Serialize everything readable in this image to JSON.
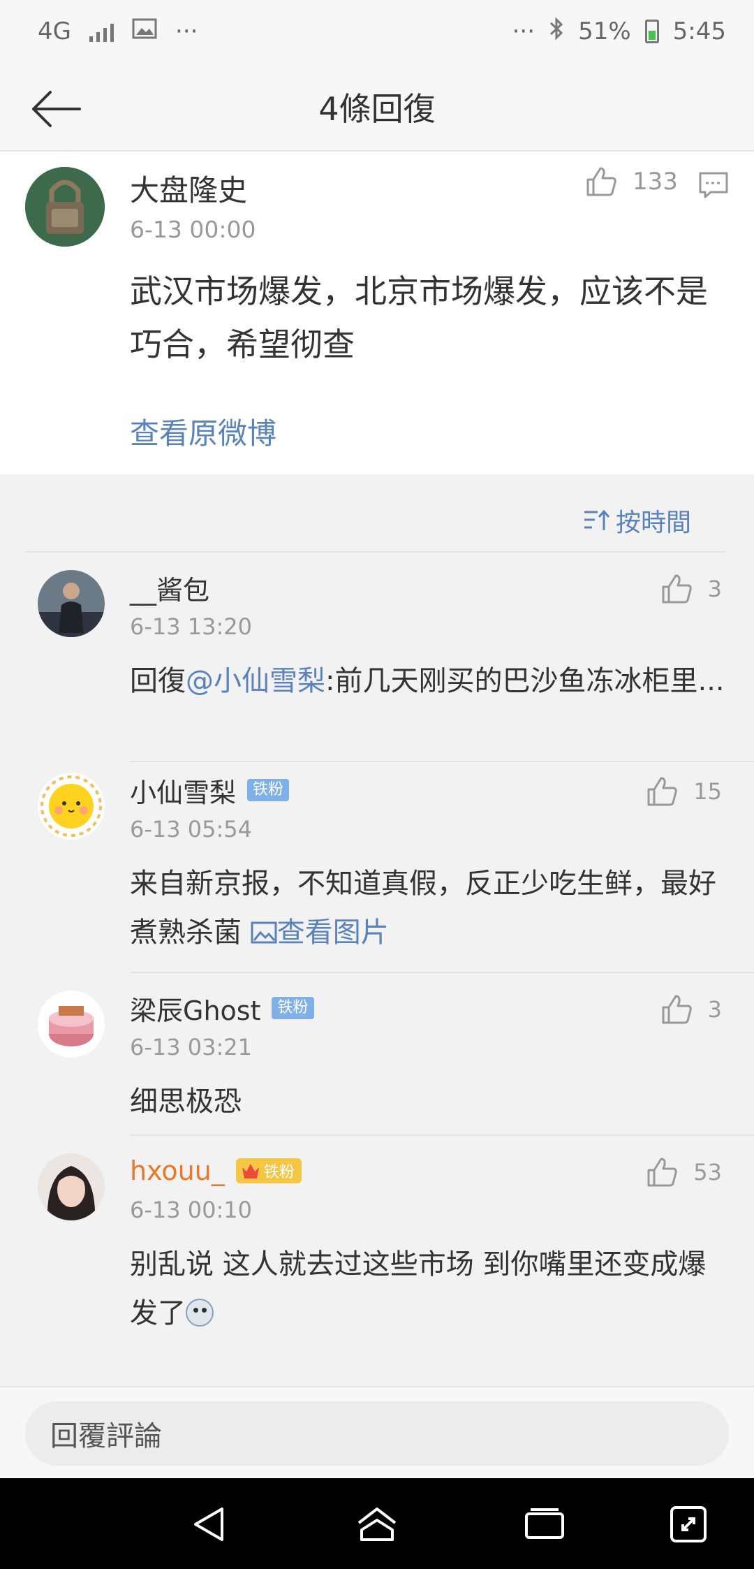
{
  "status_bar": {
    "network": "4G",
    "extra_dots": "···",
    "battery_percent": "51%",
    "time": "5:45",
    "battery_level": 0.51
  },
  "header": {
    "title": "4條回復"
  },
  "post": {
    "username": "大盘隆史",
    "time": "6-13 00:00",
    "likes": "133",
    "text": "武汉市场爆发，北京市场爆发，应该不是巧合，希望彻查",
    "view_original": "查看原微博"
  },
  "sort": {
    "label": "按時間"
  },
  "comments": [
    {
      "username": "__酱包",
      "time": "6-13 13:20",
      "likes": "3",
      "reply_prefix": "回復",
      "mention": "@小仙雪梨",
      "text": ":前几天刚买的巴沙鱼冻冰柜里..."
    },
    {
      "username": "小仙雪梨",
      "badge": "铁粉",
      "time": "6-13 05:54",
      "likes": "15",
      "text": "来自新京报，不知道真假，反正少吃生鲜，最好煮熟杀菌 ",
      "link_text": "查看图片"
    },
    {
      "username": "梁辰Ghost",
      "badge": "铁粉",
      "time": "6-13 03:21",
      "likes": "3",
      "text": "细思极恐"
    },
    {
      "username": "hxouu_",
      "badge": "铁粉",
      "badge_level": "5",
      "time": "6-13 00:10",
      "likes": "53",
      "text": "别乱说 这人就去过这些市场 到你嘴里还变成爆发了"
    }
  ],
  "reply_bar": {
    "placeholder": "回覆評論"
  },
  "colors": {
    "link": "#5a83bb",
    "orange_name": "#e8792a",
    "badge_blue": "#7fb0ea",
    "badge_gold": "#f5c544"
  }
}
